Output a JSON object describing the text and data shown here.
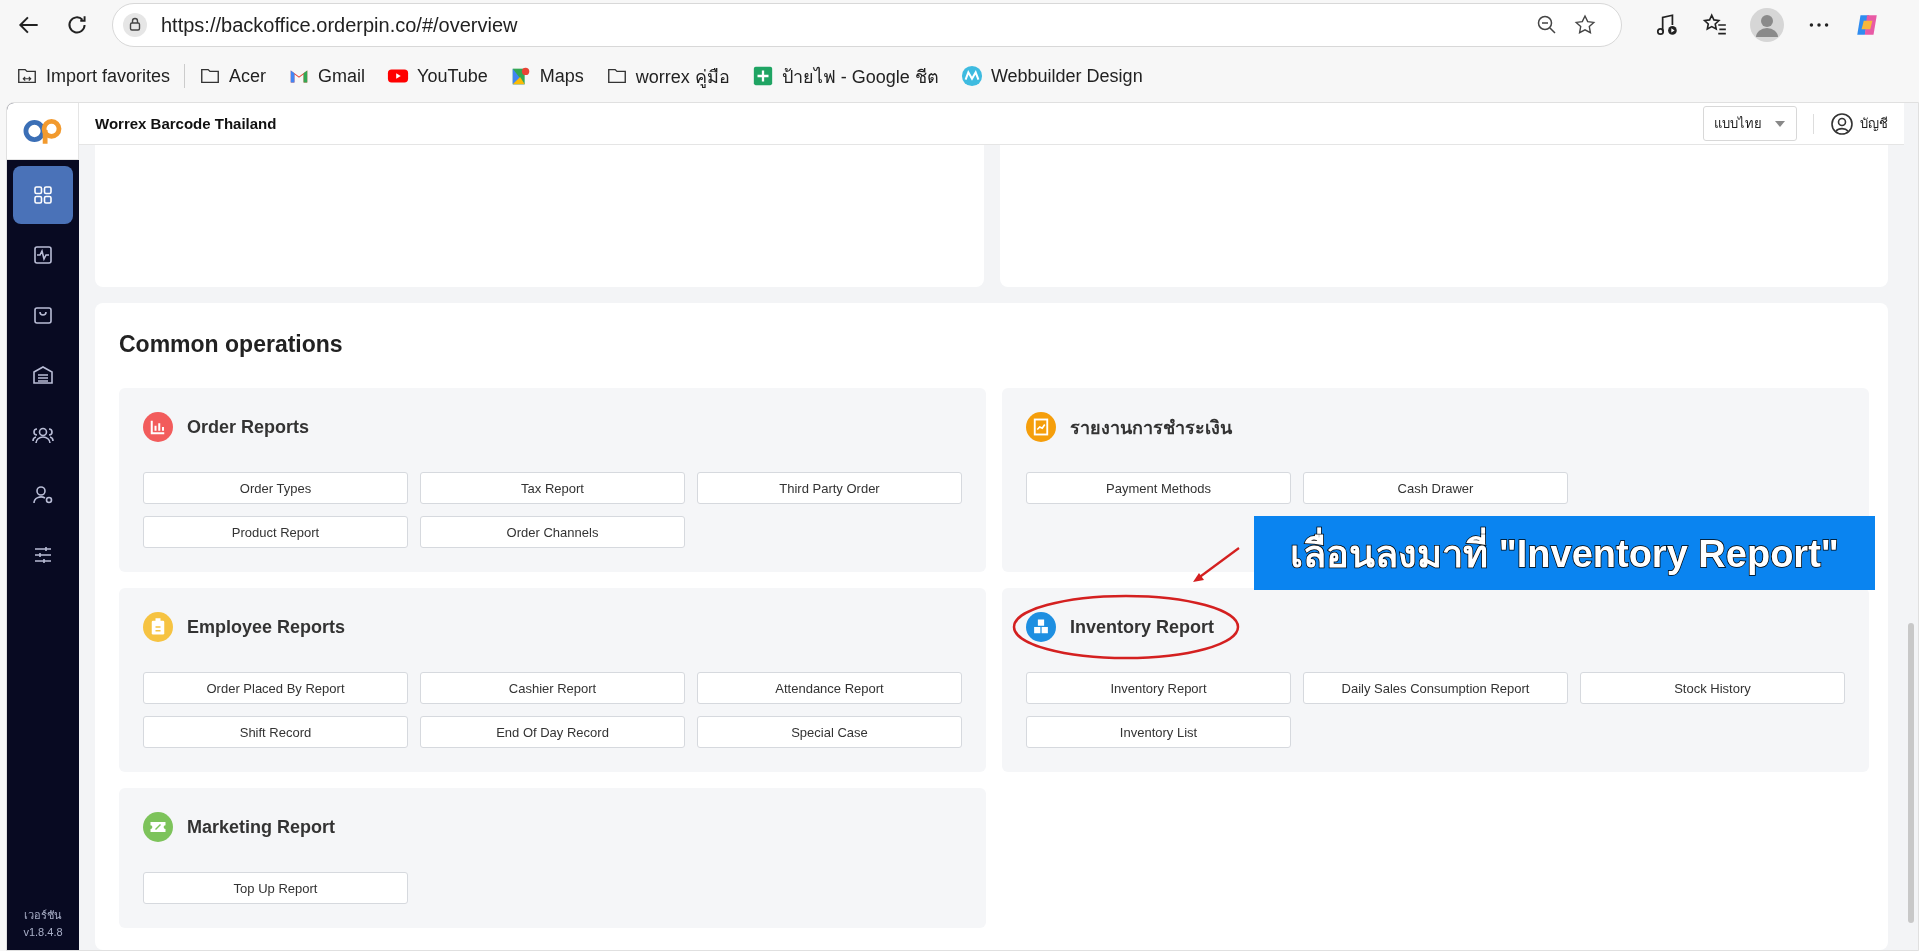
{
  "browser": {
    "url": "https://backoffice.orderpin.co/#/overview",
    "bookmarks": [
      {
        "kind": "import",
        "label": "Import favorites"
      },
      {
        "kind": "folder",
        "label": "Acer"
      },
      {
        "kind": "gmail",
        "label": "Gmail"
      },
      {
        "kind": "youtube",
        "label": "YouTube"
      },
      {
        "kind": "maps",
        "label": "Maps"
      },
      {
        "kind": "folder",
        "label": "worrex คู่มือ"
      },
      {
        "kind": "sheets",
        "label": "ป้ายไฟ - Google ชีต"
      },
      {
        "kind": "web",
        "label": "Webbuilder Design"
      }
    ]
  },
  "app": {
    "title": "Worrex Barcode Thailand",
    "language_select": {
      "value": "แบบไทย"
    },
    "account_label": "บัญชี",
    "sidebar": {
      "items": [
        {
          "kind": "grid",
          "selected": true
        },
        {
          "kind": "activity",
          "selected": false
        },
        {
          "kind": "bag",
          "selected": false
        },
        {
          "kind": "warehouse",
          "selected": false
        },
        {
          "kind": "users",
          "selected": false
        },
        {
          "kind": "user-gear",
          "selected": false
        },
        {
          "kind": "sliders",
          "selected": false
        }
      ],
      "version_label": "เวอร์ชัน",
      "version": "v1.8.4.8"
    }
  },
  "section_title": "Common operations",
  "groups": [
    {
      "title": "Order Reports",
      "kind": "chart",
      "color": "#f25c5c",
      "highlighted": false,
      "buttons": [
        "Order Types",
        "Tax Report",
        "Third Party Order",
        "Product Report",
        "Order Channels"
      ]
    },
    {
      "title": "รายงานการชำระเงิน",
      "kind": "report",
      "color": "#f59e0b",
      "highlighted": false,
      "buttons": [
        "Payment Methods",
        "Cash Drawer"
      ]
    },
    {
      "title": "Employee Reports",
      "kind": "clipboard",
      "color": "#f6c342",
      "highlighted": false,
      "buttons": [
        "Order Placed By Report",
        "Cashier Report",
        "Attendance Report",
        "Shift Record",
        "End Of Day Record",
        "Special Case"
      ]
    },
    {
      "title": "Inventory Report",
      "kind": "boxes",
      "color": "#1e8fe1",
      "highlighted": true,
      "buttons": [
        "Inventory Report",
        "Daily Sales Consumption Report",
        "Stock History",
        "Inventory List"
      ]
    },
    {
      "title": "Marketing Report",
      "kind": "ticket",
      "color": "#7dc35b",
      "highlighted": false,
      "buttons": [
        "Top Up Report"
      ]
    }
  ],
  "annotation": {
    "text": "เลื่อนลงมาที่ \"Inventory Report\""
  }
}
